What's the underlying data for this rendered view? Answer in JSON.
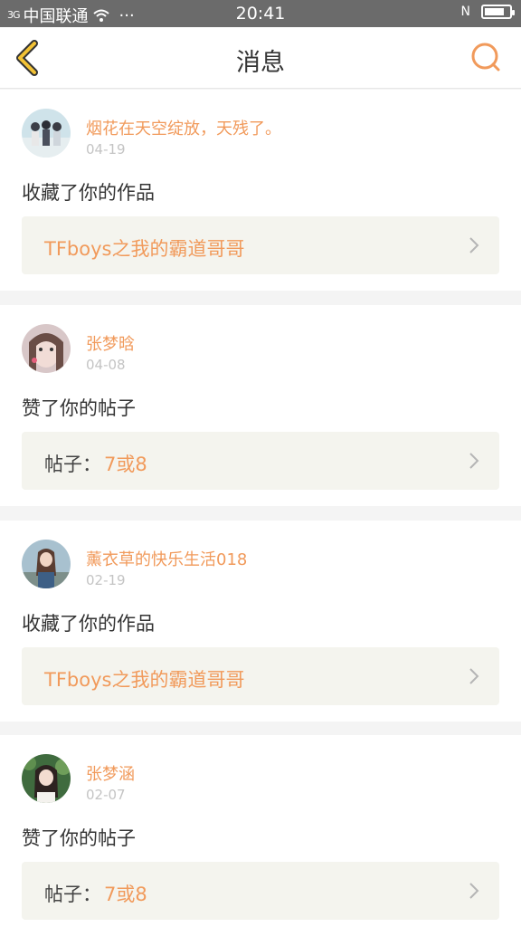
{
  "status_bar": {
    "signal": "3G",
    "carrier": "中国联通",
    "more": "···",
    "time": "20:41",
    "nfc": "N",
    "battery_level": 0.8
  },
  "header": {
    "title": "消息"
  },
  "messages": [
    {
      "username": "烟花在天空绽放，天残了。",
      "date": "04-19",
      "action": "收藏了你的作品",
      "ref_prefix": "",
      "ref_text": "TFboys之我的霸道哥哥"
    },
    {
      "username": "张梦晗",
      "date": "04-08",
      "action": "赞了你的帖子",
      "ref_prefix": "帖子：",
      "ref_text": "7或8"
    },
    {
      "username": "薰衣草的快乐生活018",
      "date": "02-19",
      "action": "收藏了你的作品",
      "ref_prefix": "",
      "ref_text": "TFboys之我的霸道哥哥"
    },
    {
      "username": "张梦涵",
      "date": "02-07",
      "action": "赞了你的帖子",
      "ref_prefix": "帖子：",
      "ref_text": "7或8"
    }
  ],
  "colors": {
    "accent": "#f19a5b",
    "back_icon": "#f2c235",
    "ref_bg": "#f4f4ee"
  }
}
